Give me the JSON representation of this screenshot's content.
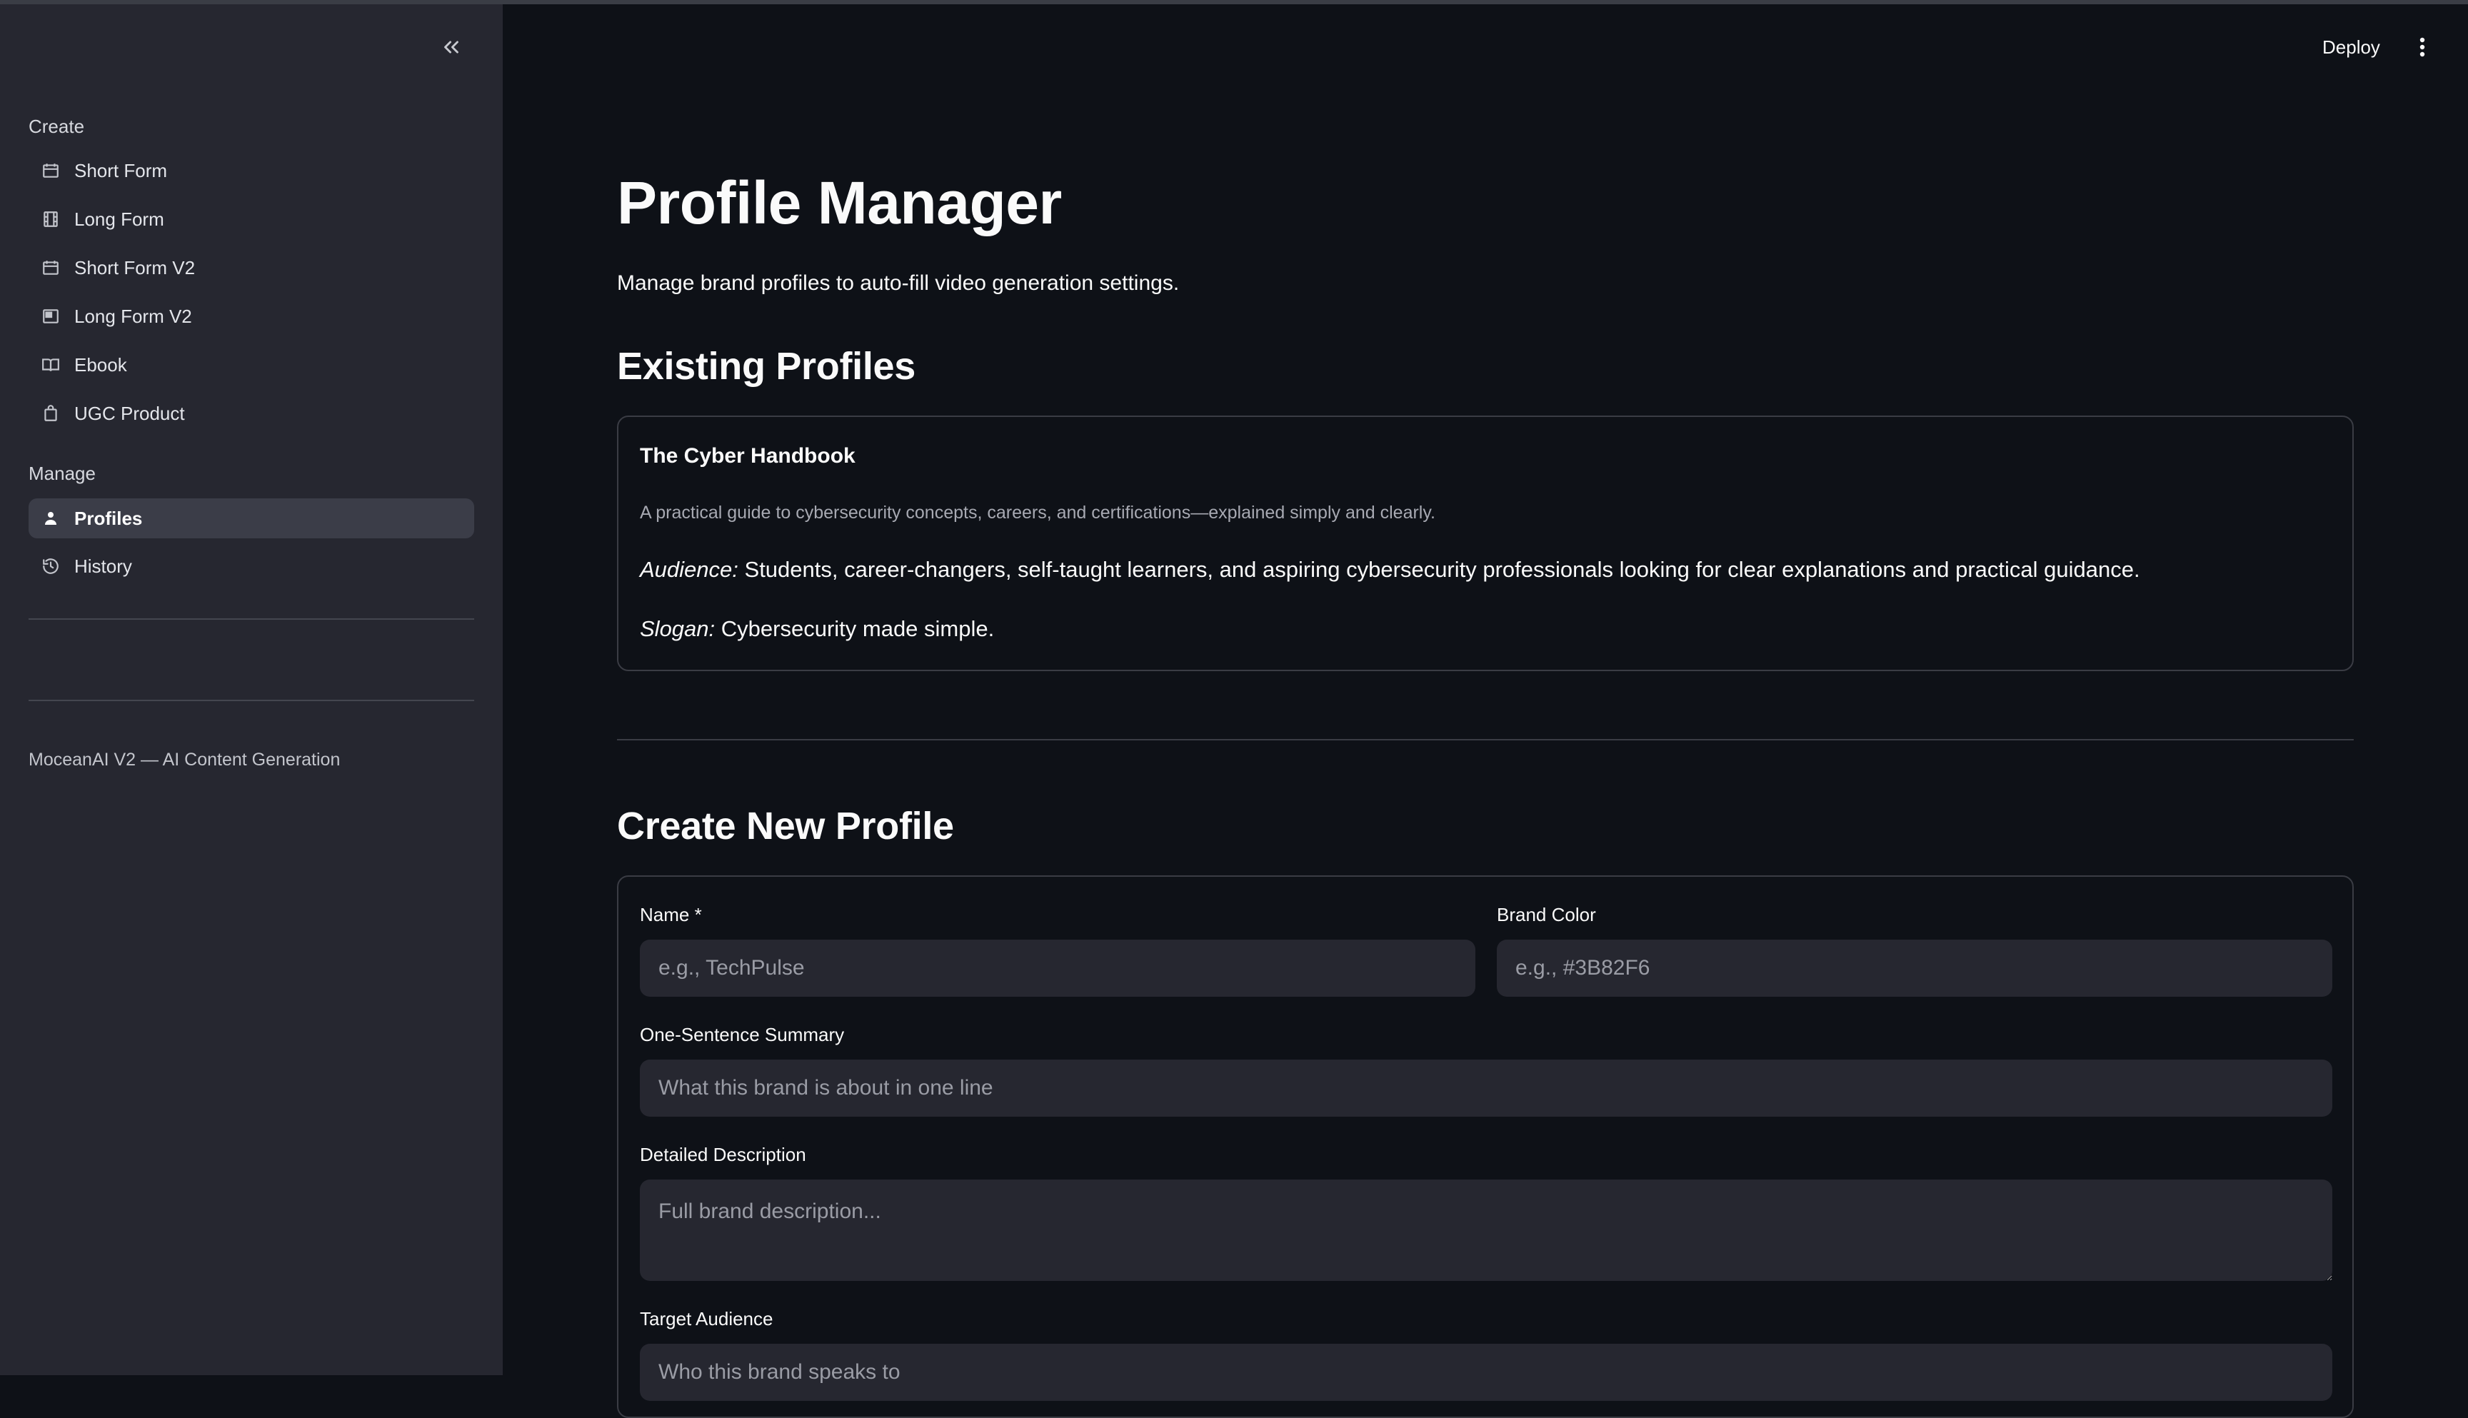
{
  "sidebar": {
    "sections": [
      {
        "title": "Create"
      },
      {
        "title": "Manage"
      }
    ],
    "create_items": [
      {
        "label": "Short Form",
        "icon": "calendar-icon"
      },
      {
        "label": "Long Form",
        "icon": "film-icon"
      },
      {
        "label": "Short Form V2",
        "icon": "calendar-icon"
      },
      {
        "label": "Long Form V2",
        "icon": "screen-icon"
      },
      {
        "label": "Ebook",
        "icon": "book-icon"
      },
      {
        "label": "UGC Product",
        "icon": "shopping-bag-icon"
      }
    ],
    "manage_items": [
      {
        "label": "Profiles",
        "icon": "person-icon",
        "active": true
      },
      {
        "label": "History",
        "icon": "history-icon",
        "active": false
      }
    ],
    "footer": "MoceanAI V2 — AI Content Generation"
  },
  "header": {
    "deploy_label": "Deploy"
  },
  "main": {
    "title": "Profile Manager",
    "subtitle": "Manage brand profiles to auto-fill video generation settings.",
    "existing_heading": "Existing Profiles",
    "profiles": [
      {
        "name": "The Cyber Handbook",
        "summary": "A practical guide to cybersecurity concepts, careers, and certifications—explained simply and clearly.",
        "audience_label": "Audience:",
        "audience": "Students, career-changers, self-taught learners, and aspiring cybersecurity professionals looking for clear explanations and practical guidance.",
        "slogan_label": "Slogan:",
        "slogan": "Cybersecurity made simple."
      }
    ],
    "create_heading": "Create New Profile",
    "form": {
      "name_label": "Name *",
      "name_placeholder": "e.g., TechPulse",
      "color_label": "Brand Color",
      "color_placeholder": "e.g., #3B82F6",
      "summary_label": "One-Sentence Summary",
      "summary_placeholder": "What this brand is about in one line",
      "description_label": "Detailed Description",
      "description_placeholder": "Full brand description...",
      "audience_label": "Target Audience",
      "audience_placeholder": "Who this brand speaks to"
    }
  },
  "colors": {
    "background": "#0e1117",
    "sidebar": "#262730",
    "input": "#262730",
    "border": "#3a3c44"
  }
}
